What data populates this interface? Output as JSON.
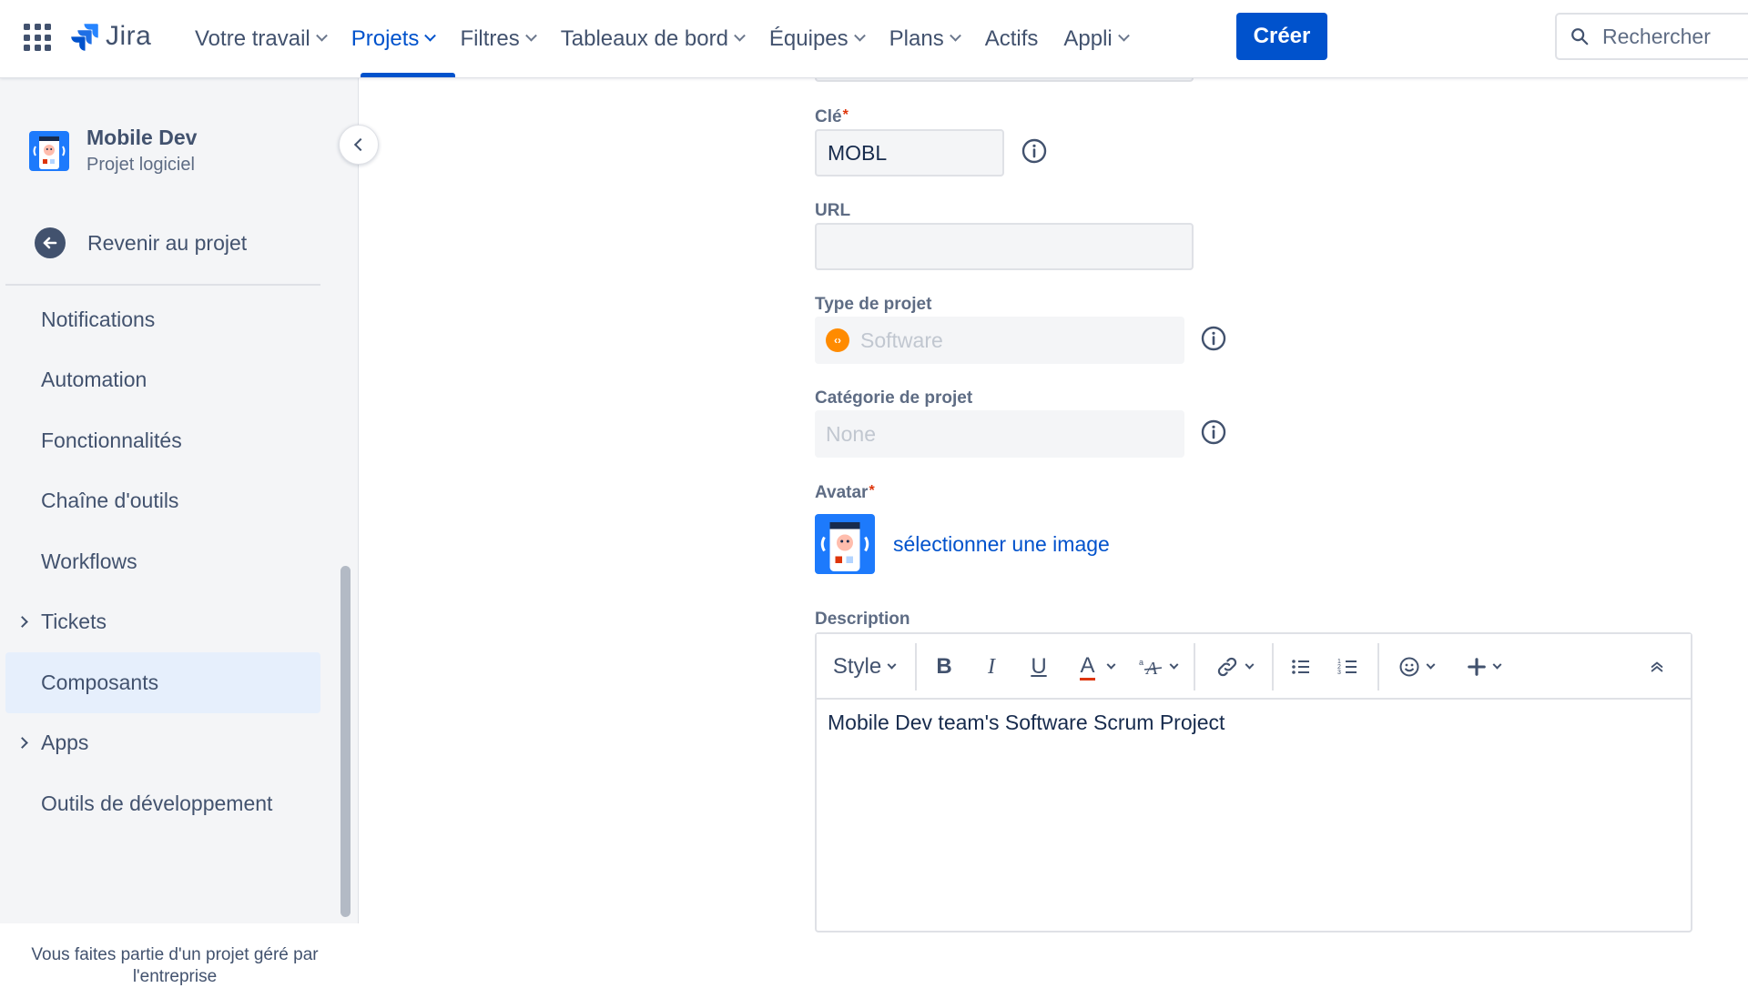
{
  "topnav": {
    "logo_text": "Jira",
    "items": [
      {
        "label": "Votre travail",
        "dropdown": true
      },
      {
        "label": "Projets",
        "dropdown": true,
        "active": true
      },
      {
        "label": "Filtres",
        "dropdown": true
      },
      {
        "label": "Tableaux de bord",
        "dropdown": true
      },
      {
        "label": "Équipes",
        "dropdown": true
      },
      {
        "label": "Plans",
        "dropdown": true
      },
      {
        "label": "Actifs",
        "dropdown": false
      },
      {
        "label": "Appli",
        "dropdown": true
      }
    ],
    "create_label": "Créer",
    "search_placeholder": "Rechercher"
  },
  "sidebar": {
    "project_name": "Mobile Dev",
    "project_type": "Projet logiciel",
    "back_label": "Revenir au projet",
    "menu": [
      {
        "label": "Notifications"
      },
      {
        "label": "Automation"
      },
      {
        "label": "Fonctionnalités"
      },
      {
        "label": "Chaîne d'outils"
      },
      {
        "label": "Workflows"
      },
      {
        "label": "Tickets",
        "expandable": true
      },
      {
        "label": "Composants",
        "selected": true
      },
      {
        "label": "Apps",
        "expandable": true
      },
      {
        "label": "Outils de développement"
      }
    ],
    "footer_line1": "Vous faites partie d'un projet géré par",
    "footer_line2": "l'entreprise"
  },
  "form": {
    "key_label": "Clé",
    "key_value": "MOBL",
    "url_label": "URL",
    "url_value": "",
    "project_type_label": "Type de projet",
    "project_type_value": "Software",
    "category_label": "Catégorie de projet",
    "category_value": "None",
    "avatar_label": "Avatar",
    "avatar_link": "sélectionner une image",
    "description_label": "Description",
    "toolbar": {
      "style_label": "Style",
      "bold": "B",
      "italic": "I",
      "underline": "U",
      "text_color": "A"
    },
    "description_text": "Mobile Dev team's Software Scrum Project"
  },
  "colors": {
    "brand_blue": "#0052cc",
    "text": "#42526e",
    "required": "#de350b",
    "software_badge": "#ff8b00",
    "sidebar_bg": "#f4f5f7",
    "selected_bg": "#e6effc"
  }
}
